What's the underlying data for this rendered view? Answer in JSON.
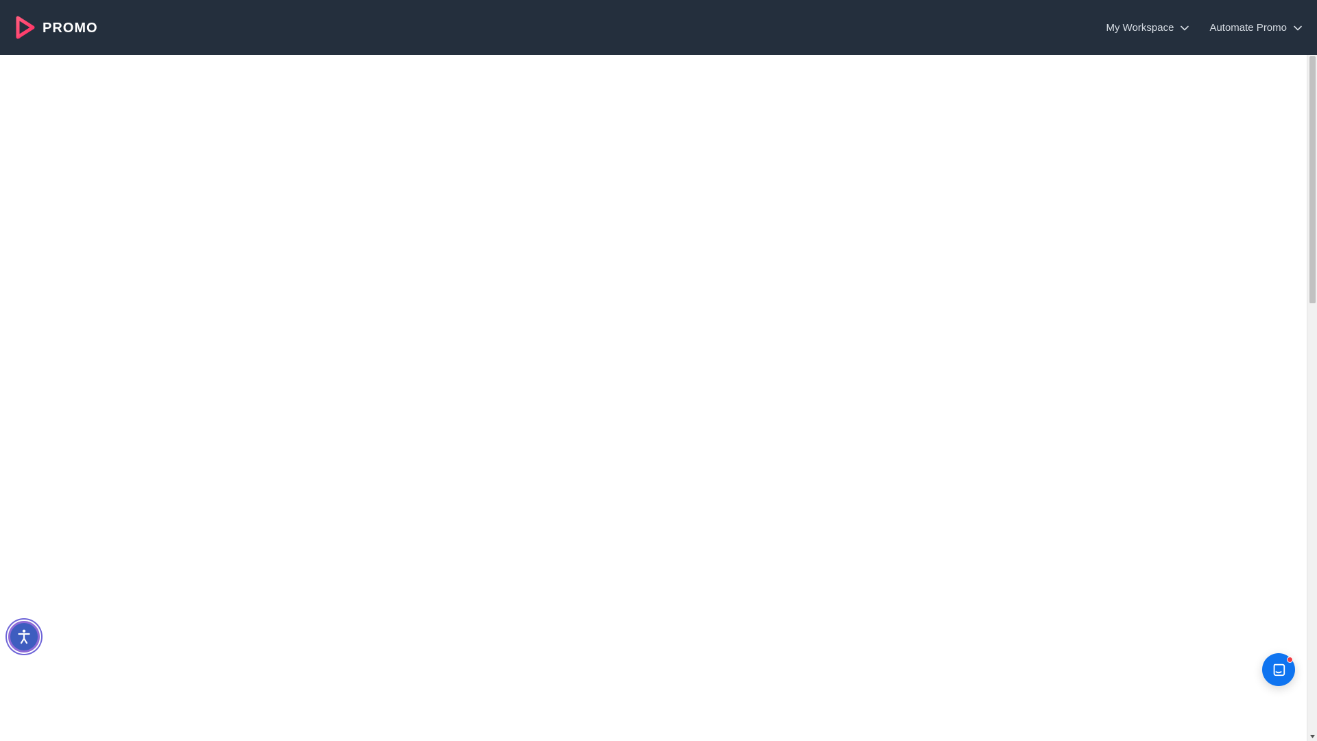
{
  "header": {
    "brand_name": "PROMO",
    "nav": [
      {
        "label": "My Workspace",
        "icon": "chevron-down-icon"
      },
      {
        "label": "Automate Promo",
        "icon": "chevron-down-icon"
      }
    ]
  },
  "widgets": {
    "accessibility": {
      "icon": "accessibility-icon"
    },
    "chat": {
      "icon": "chat-icon",
      "notification": true
    }
  },
  "colors": {
    "header_bg": "#242f3d",
    "logo_accent": "#ff3f6d",
    "chat_blue": "#0f74f0",
    "notification_red": "#ef3b44",
    "accessibility_bg": "#3e5dbf",
    "accessibility_ring": "#8f6bd7"
  }
}
